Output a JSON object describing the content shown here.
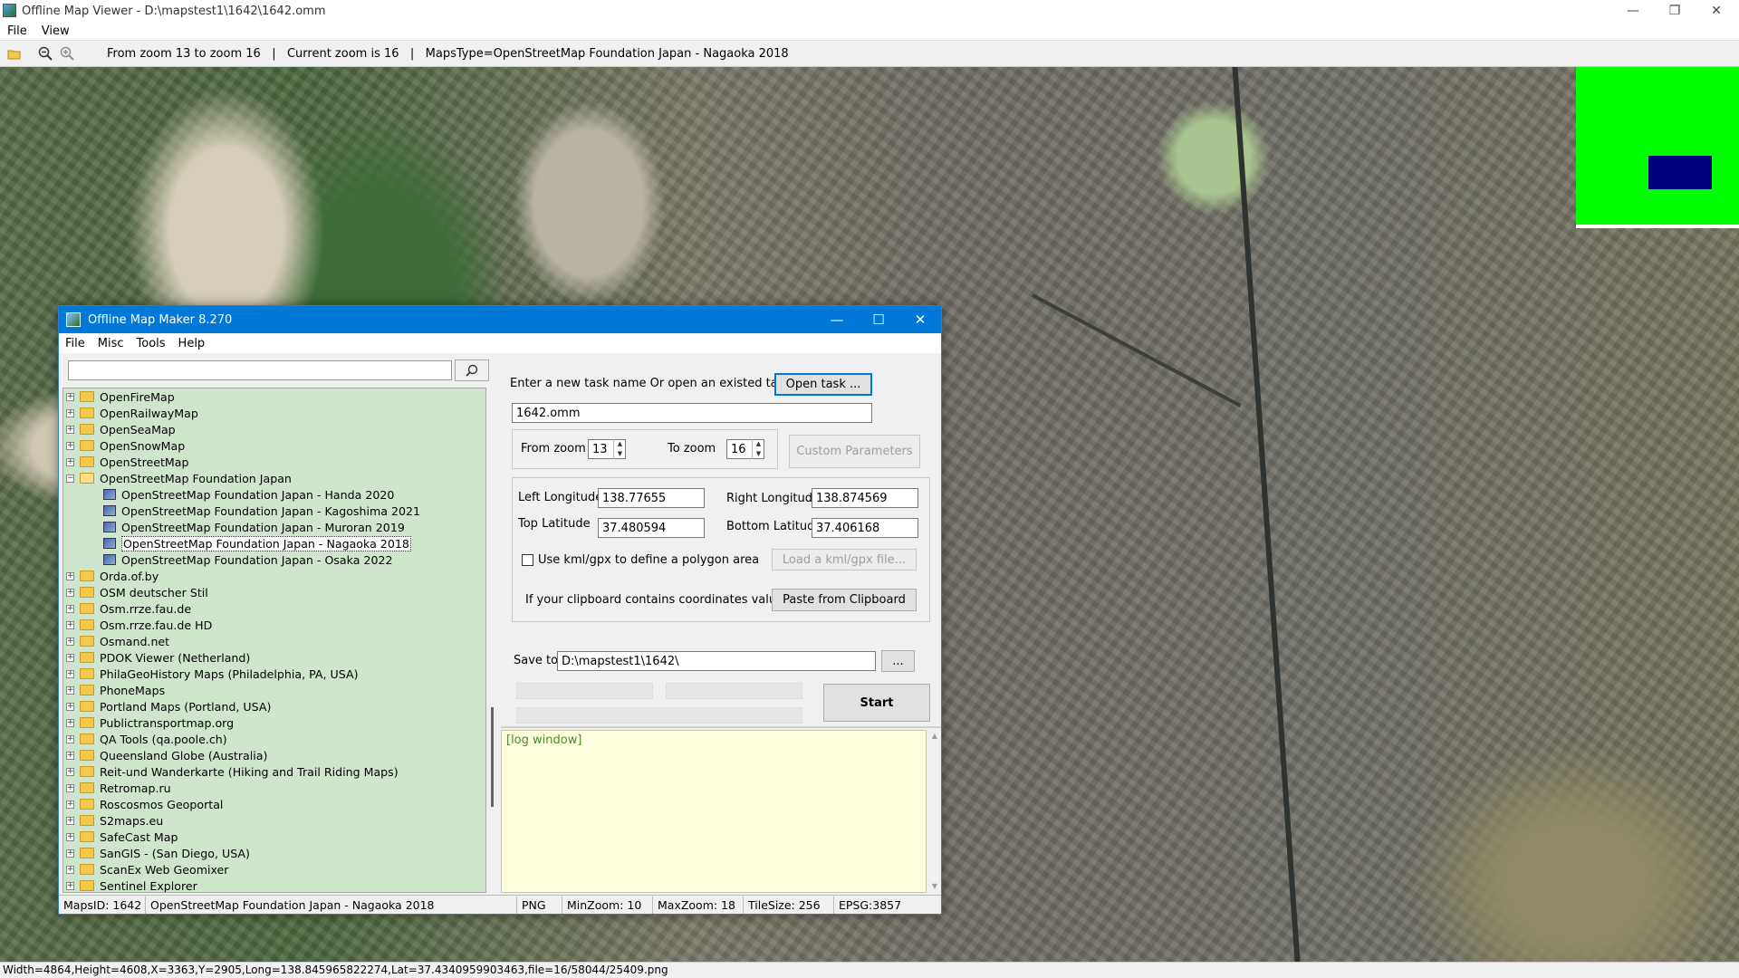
{
  "window": {
    "title": "Offline Map Viewer - D:\\mapstest1\\1642\\1642.omm",
    "menu": [
      "File",
      "View"
    ],
    "controls": {
      "minimize": "—",
      "maximize": "❐",
      "close": "✕"
    }
  },
  "toolbar": {
    "icons": [
      "folder-open-icon",
      "zoom-out-icon",
      "zoom-in-icon"
    ],
    "info": "From zoom 13 to zoom 16   |   Current zoom is 16   |   MapsType=OpenStreetMap Foundation Japan - Nagaoka 2018"
  },
  "statusbar": {
    "text": "Width=4864,Height=4608,X=3363,Y=2905,Long=138.845965822274,Lat=37.4340959903463,file=16/58044/25409.png"
  },
  "colors": {
    "accent": "#0078d7",
    "tree_bg": "#cfe5cc",
    "log_bg": "#ffffe0",
    "minimap": "#00ff00",
    "minimap_view": "#000080"
  },
  "dialog": {
    "title": "Offline Map Maker 8.270",
    "menu": [
      "File",
      "Misc",
      "Tools",
      "Help"
    ],
    "search": {
      "value": "",
      "placeholder": ""
    },
    "tree": [
      {
        "label": "OpenFireMap",
        "expanded": false
      },
      {
        "label": "OpenRailwayMap",
        "expanded": false
      },
      {
        "label": "OpenSeaMap",
        "expanded": false
      },
      {
        "label": "OpenSnowMap",
        "expanded": false
      },
      {
        "label": "OpenStreetMap",
        "expanded": false
      },
      {
        "label": "OpenStreetMap Foundation Japan",
        "expanded": true,
        "children": [
          "OpenStreetMap Foundation Japan - Handa 2020",
          "OpenStreetMap Foundation Japan - Kagoshima 2021",
          "OpenStreetMap Foundation Japan - Muroran 2019",
          "OpenStreetMap Foundation Japan - Nagaoka 2018",
          "OpenStreetMap Foundation Japan - Osaka 2022"
        ],
        "selected_child": 3
      },
      {
        "label": "Orda.of.by",
        "expanded": false
      },
      {
        "label": "OSM deutscher Stil",
        "expanded": false
      },
      {
        "label": "Osm.rrze.fau.de",
        "expanded": false
      },
      {
        "label": "Osm.rrze.fau.de HD",
        "expanded": false
      },
      {
        "label": "Osmand.net",
        "expanded": false
      },
      {
        "label": "PDOK Viewer (Netherland)",
        "expanded": false
      },
      {
        "label": "PhilaGeoHistory Maps (Philadelphia, PA, USA)",
        "expanded": false
      },
      {
        "label": "PhoneMaps",
        "expanded": false
      },
      {
        "label": "Portland Maps (Portland, USA)",
        "expanded": false
      },
      {
        "label": "Publictransportmap.org",
        "expanded": false
      },
      {
        "label": "QA Tools (qa.poole.ch)",
        "expanded": false
      },
      {
        "label": "Queensland Globe (Australia)",
        "expanded": false
      },
      {
        "label": "Reit-und Wanderkarte (Hiking and Trail Riding Maps)",
        "expanded": false
      },
      {
        "label": "Retromap.ru",
        "expanded": false
      },
      {
        "label": "Roscosmos Geoportal",
        "expanded": false
      },
      {
        "label": "S2maps.eu",
        "expanded": false
      },
      {
        "label": "SafeCast Map",
        "expanded": false
      },
      {
        "label": "SanGIS - (San Diego, USA)",
        "expanded": false
      },
      {
        "label": "ScanEx Web Geomixer",
        "expanded": false
      },
      {
        "label": "Sentinel Explorer",
        "expanded": false
      }
    ],
    "task": {
      "prompt": "Enter a new task name Or open an existed task to continue:",
      "open_button": "Open task ...",
      "name_value": "1642.omm"
    },
    "zoom": {
      "from_label": "From zoom",
      "from_value": "13",
      "to_label": "To zoom",
      "to_value": "16",
      "custom_button": "Custom Parameters"
    },
    "coords": {
      "left_lon_label": "Left Longitude",
      "left_lon": "138.77655",
      "right_lon_label": "Right Longitude",
      "right_lon": "138.874569",
      "top_lat_label": "Top Latitude",
      "top_lat": "37.480594",
      "bottom_lat_label": "Bottom Latitude",
      "bottom_lat": "37.406168",
      "kml_checkbox_label": "Use kml/gpx to define a polygon area",
      "kml_checked": false,
      "kml_button": "Load a kml/gpx file...",
      "clipboard_label": "If your clipboard contains coordinates values:",
      "clipboard_button": "Paste from Clipboard"
    },
    "save": {
      "label": "Save to:",
      "path": "D:\\mapstest1\\1642\\",
      "browse": "...",
      "start": "Start"
    },
    "log": {
      "text": "[log window]"
    },
    "status": {
      "maps_id": "MapsID: 1642",
      "maps_name": "OpenStreetMap Foundation Japan - Nagaoka 2018",
      "format": "PNG",
      "min_zoom": "MinZoom: 10",
      "max_zoom": "MaxZoom: 18",
      "tile_size": "TileSize: 256",
      "epsg": "EPSG:3857"
    }
  }
}
